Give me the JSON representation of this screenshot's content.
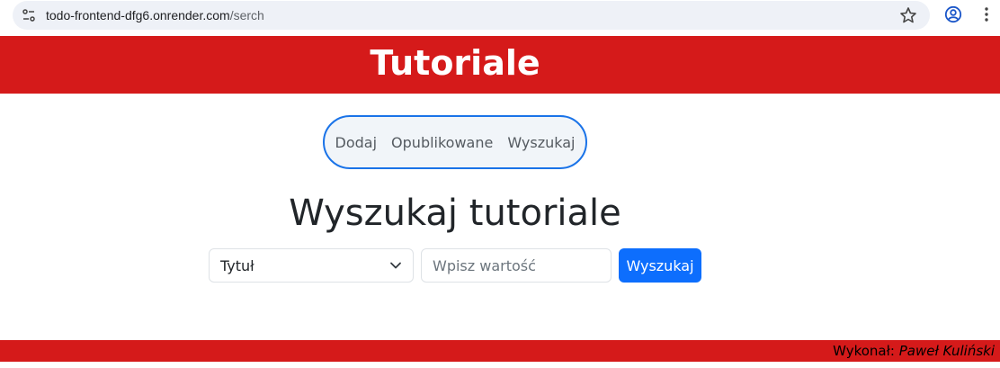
{
  "browser": {
    "url_host": "todo-frontend-dfg6.onrender.com",
    "url_path": "/serch"
  },
  "header": {
    "title": "Tutoriale",
    "color": "#d51a1a"
  },
  "nav": {
    "items": [
      {
        "label": "Dodaj"
      },
      {
        "label": "Opublikowane"
      },
      {
        "label": "Wyszukaj"
      }
    ],
    "border_color": "#1a73e8"
  },
  "main": {
    "title": "Wyszukaj tutoriale"
  },
  "search": {
    "field_select_value": "Tytuł",
    "input_value": "",
    "input_placeholder": "Wpisz wartość",
    "button_label": "Wyszukaj",
    "button_color": "#0d6efd"
  },
  "footer": {
    "label": "Wykonał:",
    "author": "Paweł Kuliński"
  },
  "icons": [
    "site-info-icon",
    "bookmark-star-icon",
    "profile-icon",
    "menu-icon",
    "chevron-down-icon"
  ]
}
